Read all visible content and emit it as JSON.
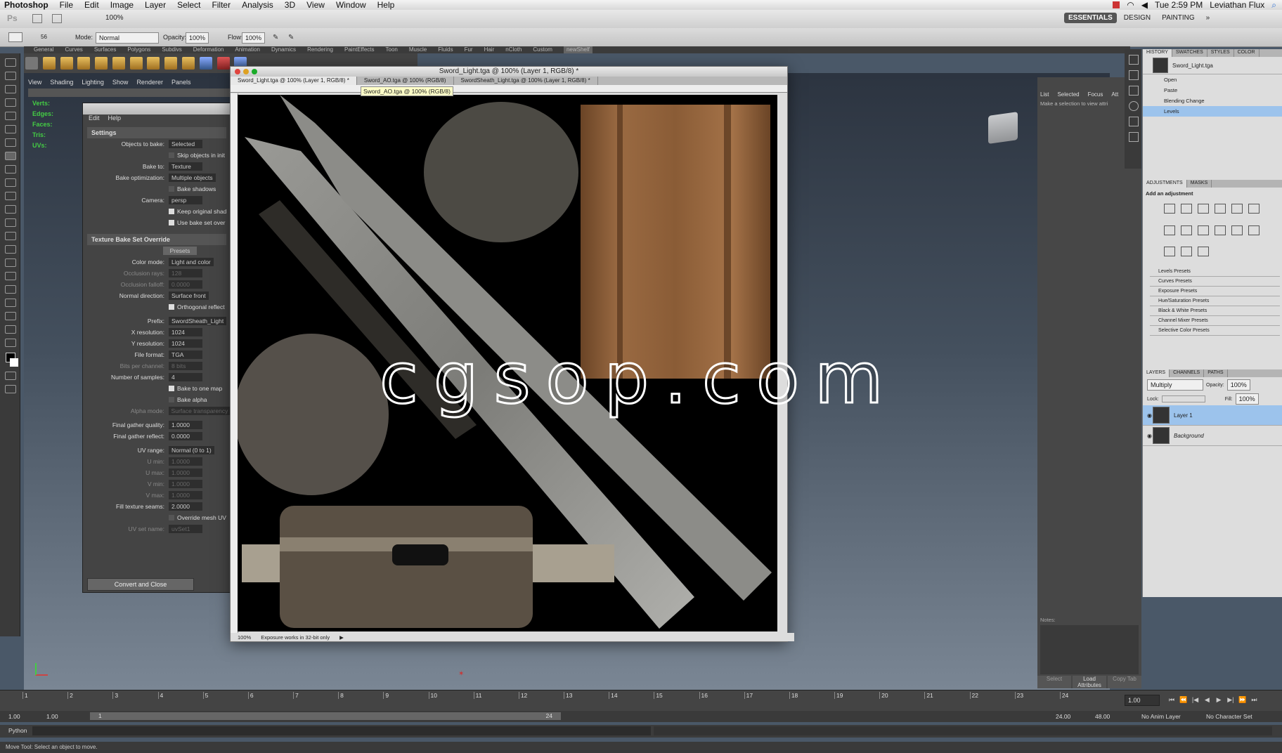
{
  "menubar": {
    "app": "Photoshop",
    "items": [
      "File",
      "Edit",
      "Image",
      "Layer",
      "Select",
      "Filter",
      "Analysis",
      "3D",
      "View",
      "Window",
      "Help"
    ],
    "clock": "Tue 2:59 PM",
    "user": "Leviathan Flux"
  },
  "psbar": {
    "zoom": "100%",
    "workspaces": [
      "ESSENTIALS",
      "DESIGN",
      "PAINTING"
    ]
  },
  "options": {
    "mode_label": "Mode:",
    "mode_value": "Normal",
    "opacity_label": "Opacity:",
    "opacity_value": "100%",
    "flow_label": "Flow:",
    "flow_value": "100%",
    "brush_size": "56"
  },
  "maya": {
    "shelf_tabs": [
      "General",
      "Curves",
      "Surfaces",
      "Polygons",
      "Subdivs",
      "Deformation",
      "Animation",
      "Dynamics",
      "Rendering",
      "PaintEffects",
      "Toon",
      "Muscle",
      "Fluids",
      "Fur",
      "Hair",
      "nCloth",
      "Custom",
      "newShelf"
    ],
    "viewport_menu": [
      "View",
      "Shading",
      "Lighting",
      "Show",
      "Renderer",
      "Panels"
    ],
    "hud": [
      "Verts:",
      "Edges:",
      "Faces:",
      "Tris:",
      "UVs:"
    ],
    "attr_tabs": [
      "List",
      "Selected",
      "Focus",
      "Att"
    ],
    "attr_msg": "Make a selection to view attri",
    "notes_label": "Notes:",
    "btn_select": "Select",
    "btn_load": "Load Attributes",
    "btn_copy": "Copy Tab"
  },
  "bake": {
    "menu": [
      "Edit",
      "Help"
    ],
    "settings_title": "Settings",
    "objects_to_bake": {
      "label": "Objects to bake:",
      "value": "Selected"
    },
    "skip": "Skip objects in init",
    "bake_to": {
      "label": "Bake to:",
      "value": "Texture"
    },
    "bake_opt": {
      "label": "Bake optimization:",
      "value": "Multiple objects"
    },
    "bake_shadows": "Bake shadows",
    "camera": {
      "label": "Camera:",
      "value": "persp"
    },
    "keep_shad": "Keep original shad",
    "use_bake": "Use bake set over",
    "override_title": "Texture Bake Set Override",
    "presets": "Presets",
    "color_mode": {
      "label": "Color mode:",
      "value": "Light and color"
    },
    "occ_rays": {
      "label": "Occlusion rays:",
      "value": "128"
    },
    "occ_falloff": {
      "label": "Occlusion falloff:",
      "value": "0.0000"
    },
    "normal_dir": {
      "label": "Normal direction:",
      "value": "Surface front"
    },
    "ortho": "Orthogonal reflect",
    "prefix": {
      "label": "Prefix:",
      "value": "SwordSheath_Light"
    },
    "xres": {
      "label": "X resolution:",
      "value": "1024"
    },
    "yres": {
      "label": "Y resolution:",
      "value": "1024"
    },
    "file_format": {
      "label": "File format:",
      "value": "TGA"
    },
    "bits": {
      "label": "Bits per channel:",
      "value": "8 bits"
    },
    "samples": {
      "label": "Number of samples:",
      "value": "4"
    },
    "bake_one": "Bake to one map",
    "bake_alpha": "Bake alpha",
    "alpha_mode": {
      "label": "Alpha mode:",
      "value": "Surface transparency"
    },
    "fg_quality": {
      "label": "Final gather quality:",
      "value": "1.0000"
    },
    "fg_reflect": {
      "label": "Final gather reflect:",
      "value": "0.0000"
    },
    "uv_range": {
      "label": "UV range:",
      "value": "Normal (0 to 1)"
    },
    "umin": {
      "label": "U min:",
      "value": "1.0000"
    },
    "umax": {
      "label": "U max:",
      "value": "1.0000"
    },
    "vmin": {
      "label": "V min:",
      "value": "1.0000"
    },
    "vmax": {
      "label": "V max:",
      "value": "1.0000"
    },
    "fill": {
      "label": "Fill texture seams:",
      "value": "2.0000"
    },
    "override_uv": "Override mesh UV",
    "uv_set": {
      "label": "UV set name:",
      "value": "uvSet1"
    },
    "convert": "Convert and Close"
  },
  "doc": {
    "title": "Sword_Light.tga @ 100% (Layer 1, RGB/8) *",
    "tabs": [
      "Sword_Light.tga @ 100% (Layer 1, RGB/8) *",
      "Sword_AO.tga @ 100% (RGB/8)",
      "SwordSheath_Light.tga @ 100% (Layer 1, RGB/8) *"
    ],
    "tooltip": "Sword_AO.tga @ 100% (RGB/8)",
    "zoom": "100%",
    "status": "Exposure works in 32-bit only"
  },
  "watermark": "cgsop.com",
  "panels": {
    "top_tabs": [
      "HISTORY",
      "SWATCHES",
      "STYLES",
      "COLOR"
    ],
    "history_source": "Sword_Light.tga",
    "history": [
      "Open",
      "Paste",
      "Blending Change",
      "Levels"
    ],
    "adj_tabs": [
      "ADJUSTMENTS",
      "MASKS"
    ],
    "add_adjust": "Add an adjustment",
    "presets": [
      "Levels Presets",
      "Curves Presets",
      "Exposure Presets",
      "Hue/Saturation Presets",
      "Black & White Presets",
      "Channel Mixer Presets",
      "Selective Color Presets"
    ],
    "layer_tabs": [
      "LAYERS",
      "CHANNELS",
      "PATHS"
    ],
    "blend": "Multiply",
    "opacity_label": "Opacity:",
    "opacity": "100%",
    "lock_label": "Lock:",
    "fill_label": "Fill:",
    "fill": "100%",
    "layers": [
      "Layer 1",
      "Background"
    ]
  },
  "timeline": {
    "ticks": [
      "1",
      "2",
      "3",
      "4",
      "5",
      "6",
      "7",
      "8",
      "9",
      "10",
      "11",
      "12",
      "13",
      "14",
      "15",
      "16",
      "17",
      "18",
      "19",
      "20",
      "21",
      "22",
      "23",
      "24"
    ],
    "current": "1.00",
    "start": "1.00",
    "start2": "1.00",
    "range_start": "1",
    "range_end": "24",
    "end1": "24.00",
    "end2": "48.00",
    "anim_layer": "No Anim Layer",
    "char_set": "No Character Set"
  },
  "cmd": {
    "label": "Python"
  },
  "help": "Move Tool: Select an object to move."
}
